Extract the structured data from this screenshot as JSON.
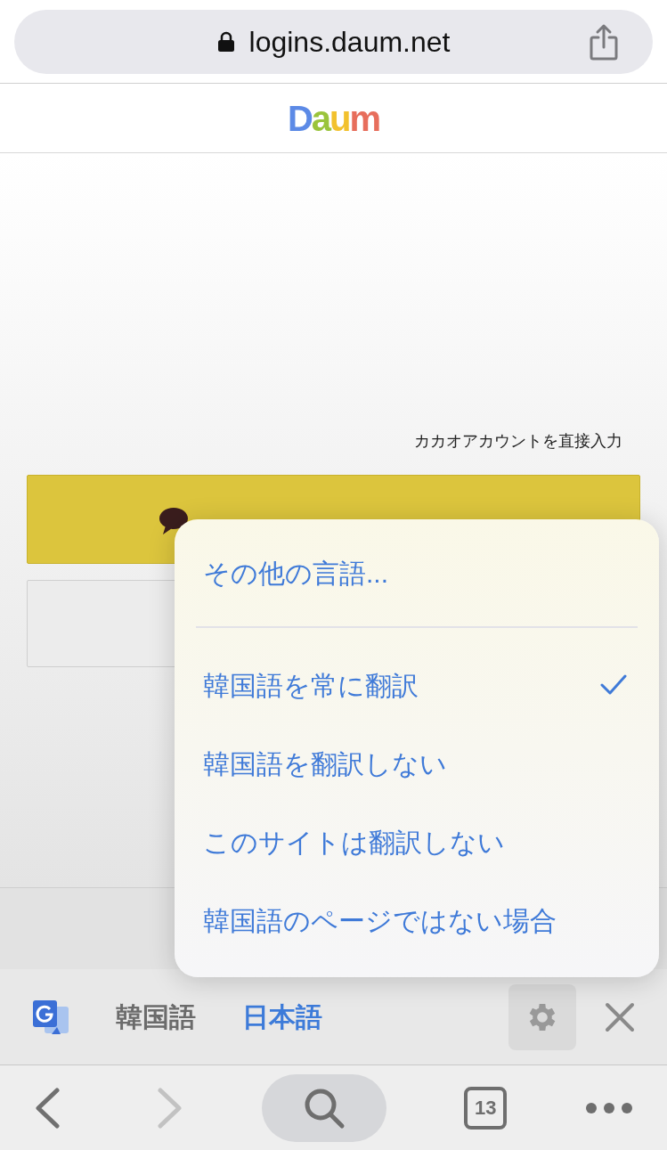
{
  "address_bar": {
    "url": "logins.daum.net"
  },
  "logo": "Daum",
  "page": {
    "direct_input_link": "カカオアカウントを直接入力"
  },
  "menu": {
    "items": [
      {
        "label": "その他の言語...",
        "kind": "more",
        "checked": false
      },
      {
        "label": "韓国語を常に翻訳",
        "kind": "option",
        "checked": true
      },
      {
        "label": "韓国語を翻訳しない",
        "kind": "option",
        "checked": false
      },
      {
        "label": "このサイトは翻訳しない",
        "kind": "option",
        "checked": false
      },
      {
        "label": "韓国語のページではない場合",
        "kind": "option",
        "checked": false
      }
    ]
  },
  "translate_bar": {
    "languages": [
      {
        "label": "韓国語",
        "selected": false
      },
      {
        "label": "日本語",
        "selected": true
      }
    ]
  },
  "toolbar": {
    "tab_count": "13"
  }
}
